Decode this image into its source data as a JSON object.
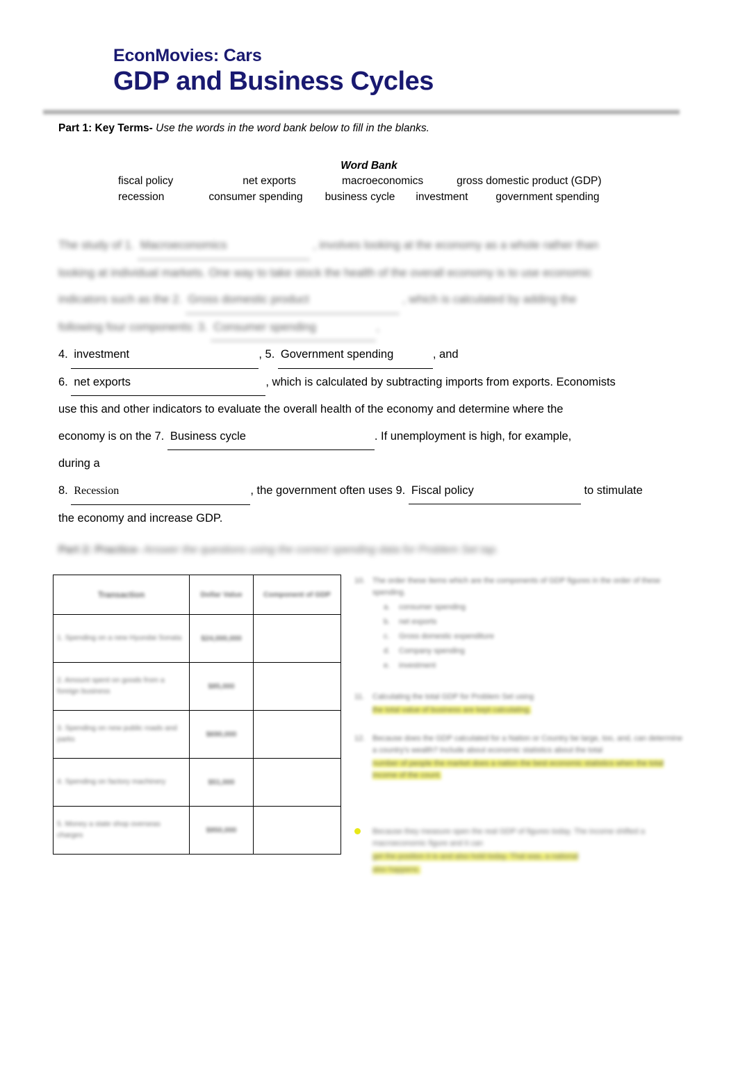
{
  "document": {
    "header": {
      "subtitle": "EconMovies: Cars",
      "title": "GDP and Business Cycles",
      "title_color": "#191970"
    },
    "part1": {
      "label": "Part 1: Key Terms-",
      "instruction": "Use the words in the word bank below to fill in the blanks."
    },
    "word_bank": {
      "heading": "Word Bank",
      "row1": [
        "fiscal policy",
        "net exports",
        "macroeconomics",
        "gross domestic product (GDP)"
      ],
      "row2": [
        "recession",
        "consumer spending",
        "business cycle",
        "investment",
        "government spending"
      ]
    },
    "paragraph": {
      "line1_a": "The study of 1.",
      "line1_answer": "Macroeconomics",
      "line1_b": ", involves looking at the economy as a whole rather than",
      "line2": "looking at individual markets.  One way to take stock the health of the overall economy is to use economic",
      "line3_a": "indicators such as the 2.",
      "line3_answer": "Gross domestic product",
      "line3_b": ", which is calculated by adding the",
      "line4_a": "following four components:  3.",
      "line4_answer": "Consumer spending",
      "line4_b": ",",
      "line5_num": "4.",
      "line5_answer": "investment",
      "line5_mid": ", 5.",
      "line5_answer2": "Government spending",
      "line5_end": ", and",
      "line6_num": "6.",
      "line6_answer": "net exports",
      "line6_rest": ", which is calculated by subtracting imports from exports.  Economists",
      "line7": "use this and other indicators to evaluate the overall health of the economy and determine where the",
      "line8_a": "economy is on the 7.",
      "line8_answer": "Business cycle",
      "line8_b": ". If unemployment is high, for example,",
      "line9": "during a",
      "line10_num": "8.",
      "line10_answer": "Recession",
      "line10_mid": ", the government often uses 9.",
      "line10_answer2": "Fiscal policy",
      "line10_end": "to stimulate",
      "line11": "the economy and increase GDP."
    },
    "part2": {
      "label": "Part 2: Practice-",
      "instruction": "Answer the questions using the correct spending data for Problem Set tap."
    },
    "table": {
      "headers": [
        "Transaction",
        "Dollar Value",
        "Component of GDP"
      ],
      "rows": [
        {
          "desc": "1.  Spending on a new Hyundai Sonata",
          "amount": "$24,000,000",
          "category": ""
        },
        {
          "desc": "2.  Amount spent on goods from a foreign business",
          "amount": "$85,000",
          "category": ""
        },
        {
          "desc": "3.  Spending on new public roads and parks",
          "amount": "$690,000",
          "category": ""
        },
        {
          "desc": "4.  Spending on factory machinery",
          "amount": "$51,000",
          "category": ""
        },
        {
          "desc": "5.  Money a state shop overseas charges",
          "amount": "$950,000",
          "category": ""
        }
      ]
    },
    "questions": [
      {
        "number": "10.",
        "text": "The order these items which are the components of GDP figures in the order of these spending.",
        "sub_items": [
          {
            "letter": "a.",
            "text": "consumer spending"
          },
          {
            "letter": "b.",
            "text": "net exports"
          },
          {
            "letter": "c.",
            "text": "Gross domestic expenditure"
          },
          {
            "letter": "d.",
            "text": "Company spending"
          },
          {
            "letter": "e.",
            "text": "investment"
          }
        ],
        "highlight": ""
      },
      {
        "number": "11.",
        "text": "Calculating the total GDP for Problem Set using",
        "highlighted": "the total value of business are kept calculating."
      },
      {
        "number": "12.",
        "text": "Because does the GDP calculated for a Nation or Country be large, too, and, can determine a country's wealth? Include about economic statistics about the total",
        "highlighted": "number of people the market does a nation the best economic statistics when the total income of the count."
      },
      {
        "number": "",
        "bullet": true,
        "text": "Because they measure open the real GDP of figures today. The income shifted a macroeconomic figure and it can",
        "highlighted": "get the position it is and also hold today. That was, a national",
        "highlighted2": "also happens."
      }
    ]
  }
}
